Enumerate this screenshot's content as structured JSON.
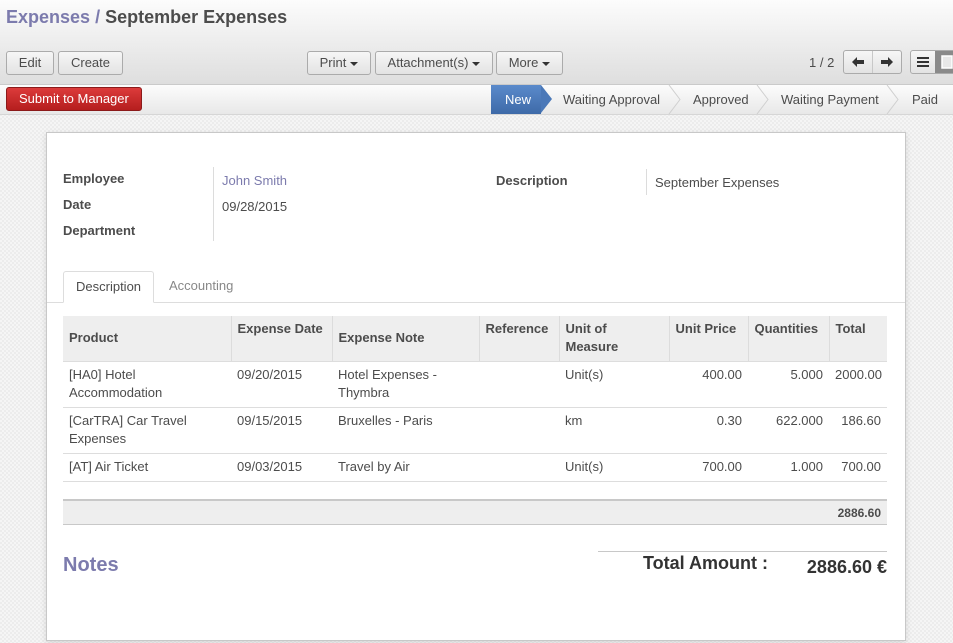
{
  "breadcrumb": {
    "parent": "Expenses",
    "separator": "/",
    "current": "September Expenses"
  },
  "toolbar": {
    "edit_label": "Edit",
    "create_label": "Create",
    "print_label": "Print",
    "attachments_label": "Attachment(s)",
    "more_label": "More",
    "pager": "1 / 2"
  },
  "statusbar": {
    "submit_label": "Submit to Manager",
    "stages": [
      "New",
      "Waiting Approval",
      "Approved",
      "Waiting Payment",
      "Paid"
    ],
    "active_stage": "New"
  },
  "form": {
    "employee_label": "Employee",
    "employee_value": "John Smith",
    "date_label": "Date",
    "date_value": "09/28/2015",
    "department_label": "Department",
    "department_value": "",
    "description_label": "Description",
    "description_value": "September Expenses"
  },
  "tabs": [
    "Description",
    "Accounting"
  ],
  "lines": {
    "columns": [
      "Product",
      "Expense Date",
      "Expense Note",
      "Reference",
      "Unit of Measure",
      "Unit Price",
      "Quantities",
      "Total"
    ],
    "rows": [
      {
        "product": "[HA0] Hotel Accommodation",
        "date": "09/20/2015",
        "note": "Hotel Expenses - Thymbra",
        "reference": "",
        "uom": "Unit(s)",
        "unit_price": "400.00",
        "qty": "5.000",
        "total": "2000.00"
      },
      {
        "product": "[CarTRA] Car Travel Expenses",
        "date": "09/15/2015",
        "note": "Bruxelles - Paris",
        "reference": "",
        "uom": "km",
        "unit_price": "0.30",
        "qty": "622.000",
        "total": "186.60"
      },
      {
        "product": "[AT] Air Ticket",
        "date": "09/03/2015",
        "note": "Travel by Air",
        "reference": "",
        "uom": "Unit(s)",
        "unit_price": "700.00",
        "qty": "1.000",
        "total": "700.00"
      }
    ],
    "sum_total": "2886.60"
  },
  "footer": {
    "notes_label": "Notes",
    "total_label": "Total Amount :",
    "total_value": "2886.60 €"
  },
  "colors": {
    "link": "#7c7bad",
    "active_stage": "#4a78b8",
    "submit": "#c9302c"
  }
}
